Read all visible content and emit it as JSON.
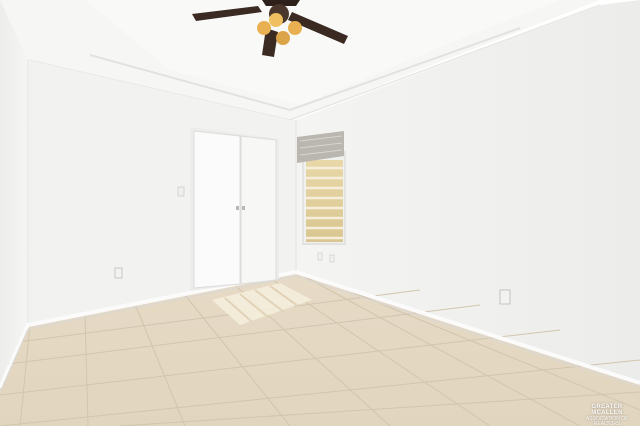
{
  "photo": {
    "subject": "empty-bedroom-interior",
    "colors": {
      "wall": "#f3f3f1",
      "wall_shadow": "#e4e4e2",
      "ceiling": "#f7f7f6",
      "floor_tile": "#e8dcc8",
      "grout": "#cfc2ad",
      "baseboard": "#fafafa",
      "door": "#fbfbfb",
      "fan_blade": "#3a2a22",
      "fan_light": "#e8b050"
    }
  },
  "watermark": {
    "line1": "GREATER MCALLEN",
    "line2": "ASSOCIATION OF REALTORS"
  }
}
